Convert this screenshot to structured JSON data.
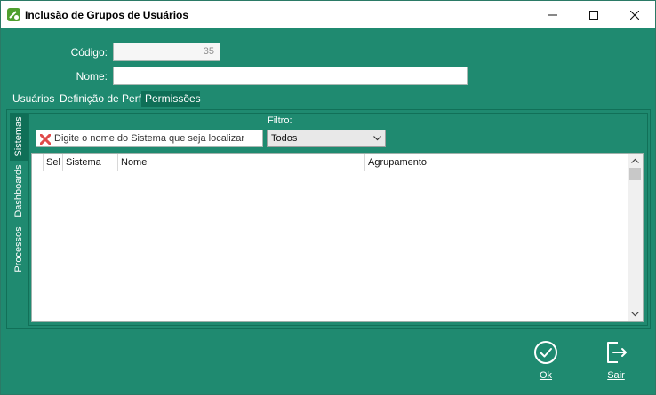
{
  "window": {
    "title": "Inclusão de Grupos de Usuários",
    "controls": {
      "minimize": "minimize-icon",
      "maximize": "maximize-icon",
      "close": "close-icon"
    }
  },
  "form": {
    "codigo_label": "Código:",
    "codigo_value": "35",
    "nome_label": "Nome:",
    "nome_value": ""
  },
  "tabs": [
    {
      "label": "Usuários",
      "active": false
    },
    {
      "label": "Definição de Perfil",
      "active": false
    },
    {
      "label": "Permissões",
      "active": true
    }
  ],
  "side_tabs": [
    {
      "label": "Sistemas",
      "active": true
    },
    {
      "label": "Dashboards",
      "active": false
    },
    {
      "label": "Processos",
      "active": false
    }
  ],
  "filter": {
    "search_placeholder": "Digite o nome do Sistema que seja localizar",
    "label": "Filtro:",
    "selected": "Todos"
  },
  "grid": {
    "columns": [
      "Sel",
      "Sistema",
      "Nome",
      "Agrupamento"
    ],
    "rows": []
  },
  "actions": {
    "ok_label": "Ok",
    "sair_label": "Sair"
  },
  "colors": {
    "background": "#1f8a70",
    "active_tab": "#0f6f57",
    "accent": "#ffffff"
  }
}
